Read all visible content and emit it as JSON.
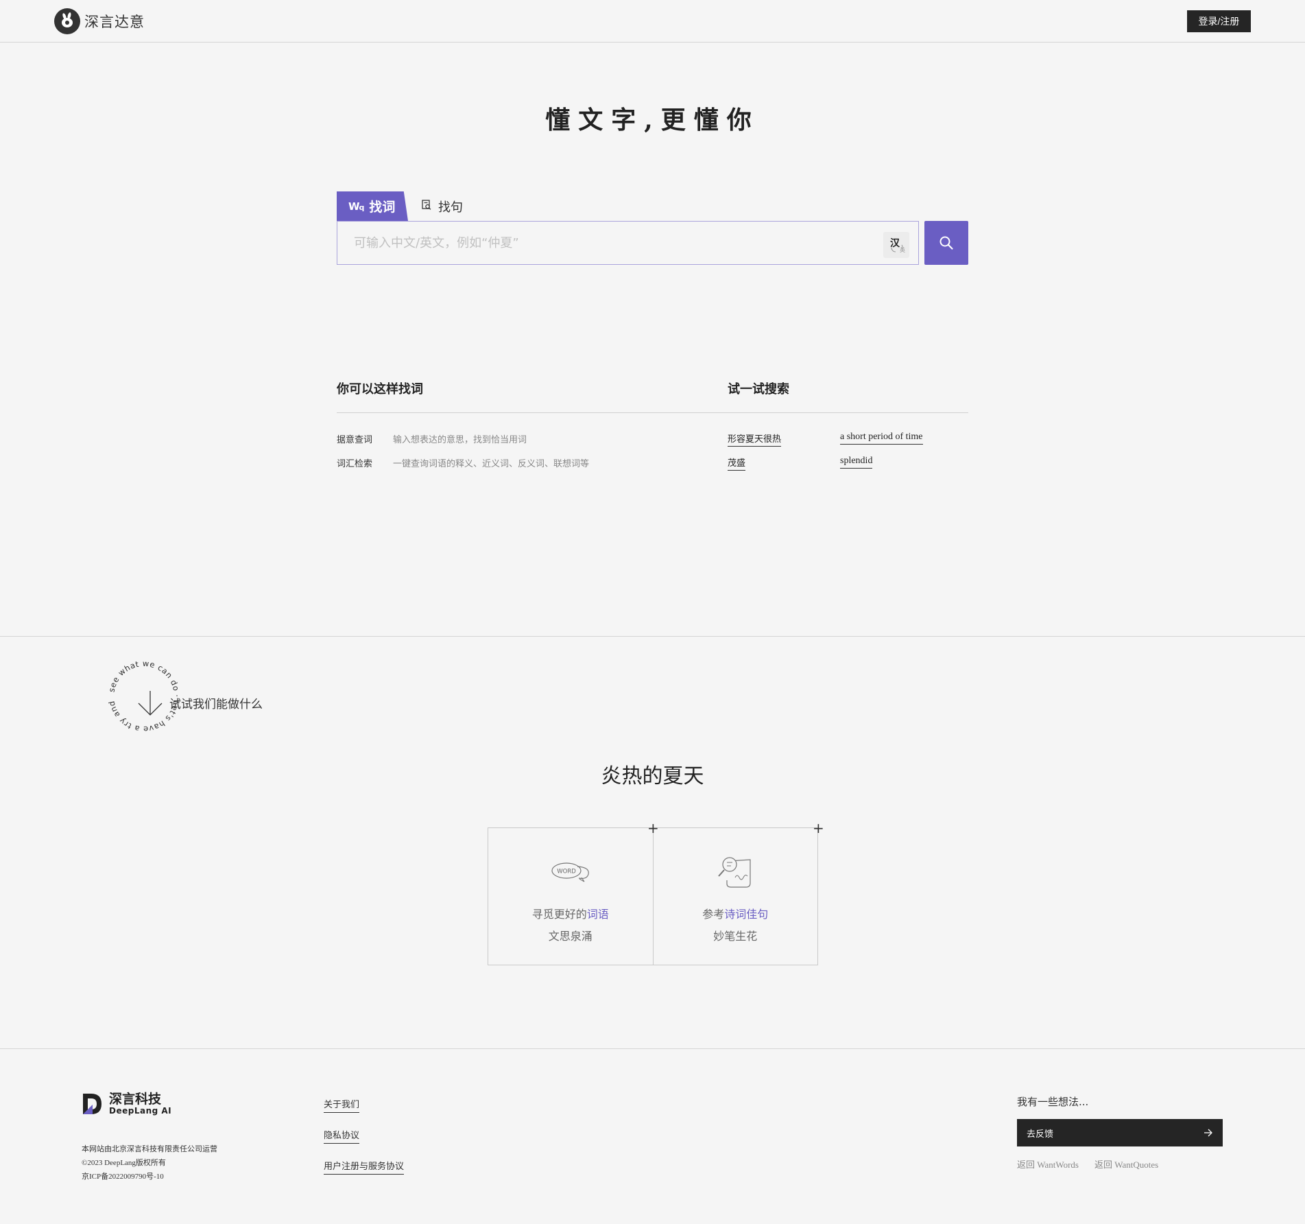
{
  "header": {
    "brand_name": "深言达意",
    "login_label": "登录/注册"
  },
  "hero": {
    "slogan": "懂文字,更懂你"
  },
  "search": {
    "tabs": [
      {
        "label": "找词",
        "active": true
      },
      {
        "label": "找句",
        "active": false
      }
    ],
    "placeholder": "可输入中文/英文，例如“仲夏”",
    "lang_toggle_main": "汉",
    "lang_toggle_sub": "英"
  },
  "tips": {
    "how_title": "你可以这样找词",
    "how_items": [
      {
        "key": "据意查词",
        "desc": "输入想表达的意思，找到恰当用词"
      },
      {
        "key": "词汇检索",
        "desc": "一键查询词语的释义、近义词、反义词、联想词等"
      }
    ],
    "try_title": "试一试搜索",
    "try_items": [
      "形容夏天很热",
      "a short period of time",
      "茂盛",
      "splendid"
    ]
  },
  "showcase": {
    "circle_text": "see what we can do · Let's have a try and",
    "circle_label": "试试我们能做什么",
    "heading": "炎热的夏天",
    "cards": [
      {
        "art": "WORD",
        "line1_prefix": "寻觅更好的",
        "line1_highlight": "词语",
        "line2": "文思泉涌"
      },
      {
        "art": "magnifier-scroll-icon",
        "line1_prefix": "参考",
        "line1_highlight": "诗词佳句",
        "line2": "妙笔生花"
      }
    ]
  },
  "footer": {
    "brand_name": "深言科技",
    "brand_sub": "DeepLang AI",
    "info": [
      "本网站由北京深言科技有限责任公司运营",
      "©2023 DeepLang版权所有",
      "京ICP备2022009790号-10"
    ],
    "links": [
      "关于我们",
      "隐私协议",
      "用户注册与服务协议"
    ],
    "feedback_title": "我有一些想法...",
    "feedback_button": "去反馈",
    "return_links": [
      "返回 WantWords",
      "返回 WantQuotes"
    ]
  },
  "colors": {
    "accent": "#6a5ec3",
    "dark": "#252525",
    "background": "#f5f5f5"
  }
}
